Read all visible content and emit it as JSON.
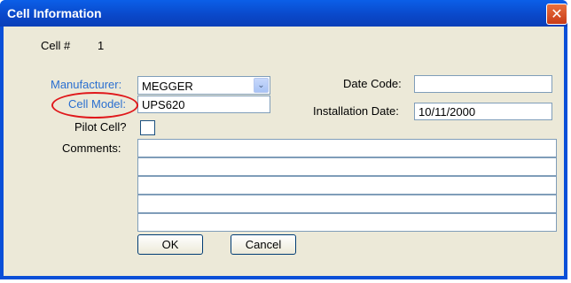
{
  "window": {
    "title": "Cell Information",
    "close_glyph": "✕"
  },
  "cell": {
    "label": "Cell #",
    "number": "1"
  },
  "manufacturer": {
    "label": "Manufacturer:",
    "value": "MEGGER",
    "dropdown_icon": "chevron-down-icon"
  },
  "cell_model": {
    "label": "Cell Model:",
    "value": "UPS620"
  },
  "pilot": {
    "label": "Pilot Cell?",
    "checked": false
  },
  "date_code": {
    "label": "Date Code:",
    "value": ""
  },
  "installation_date": {
    "label": "Installation Date:",
    "value": "10/11/2000"
  },
  "comments": {
    "label": "Comments:",
    "lines": [
      "",
      "",
      "",
      "",
      ""
    ]
  },
  "buttons": {
    "ok": "OK",
    "cancel": "Cancel"
  },
  "colors": {
    "title_bar": "#0a4fd8",
    "client_bg": "#ece9d8",
    "link_label": "#2a6fd0",
    "highlight": "#e0181b"
  }
}
